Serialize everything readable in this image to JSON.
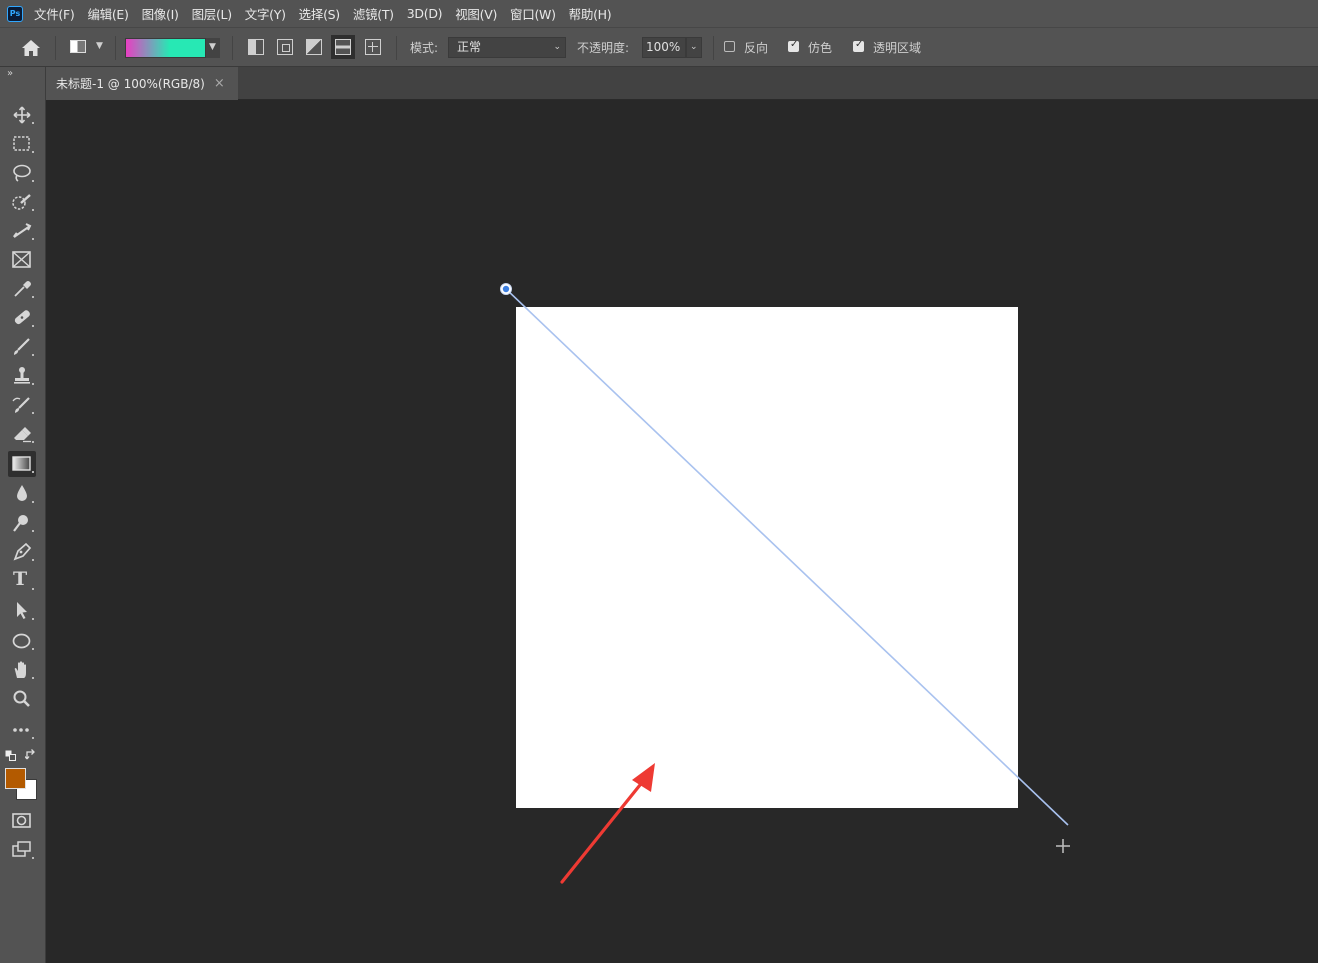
{
  "app": {
    "logo_text": "Ps",
    "menu": [
      "文件(F)",
      "编辑(E)",
      "图像(I)",
      "图层(L)",
      "文字(Y)",
      "选择(S)",
      "滤镜(T)",
      "3D(D)",
      "视图(V)",
      "窗口(W)",
      "帮助(H)"
    ]
  },
  "options": {
    "gradient_colors": [
      "#e83fc2",
      "#27e8b4"
    ],
    "mode_label": "模式:",
    "mode_value": "正常",
    "opacity_label": "不透明度:",
    "opacity_value": "100%",
    "reverse_label": "反向",
    "reverse_checked": false,
    "dither_label": "仿色",
    "dither_checked": true,
    "transparency_label": "透明区域",
    "transparency_checked": true
  },
  "document": {
    "tab_title": "未标题-1 @ 100%(RGB/8)",
    "close_glyph": "×",
    "canvas_color": "#ffffff"
  },
  "toolbar": {
    "collapse_glyph": "»",
    "tools": [
      "move-icon",
      "rectangular-marquee-icon",
      "lasso-icon",
      "quick-selection-icon",
      "crop-icon",
      "frame-icon",
      "eyedropper-icon",
      "healing-brush-icon",
      "brush-icon",
      "clone-stamp-icon",
      "history-brush-icon",
      "eraser-icon",
      "gradient-icon",
      "blur-icon",
      "dodge-icon",
      "pen-icon",
      "type-icon",
      "path-selection-icon",
      "ellipse-icon",
      "hand-icon",
      "zoom-icon",
      "more-tools-icon"
    ],
    "active_tool": "gradient-icon",
    "foreground_color": "#b35a00",
    "background_color": "#ffffff",
    "type_glyph": "T"
  },
  "annotation": {
    "arrow_color": "#ee3a33",
    "gradient_line_color": "#a9c2ef"
  }
}
